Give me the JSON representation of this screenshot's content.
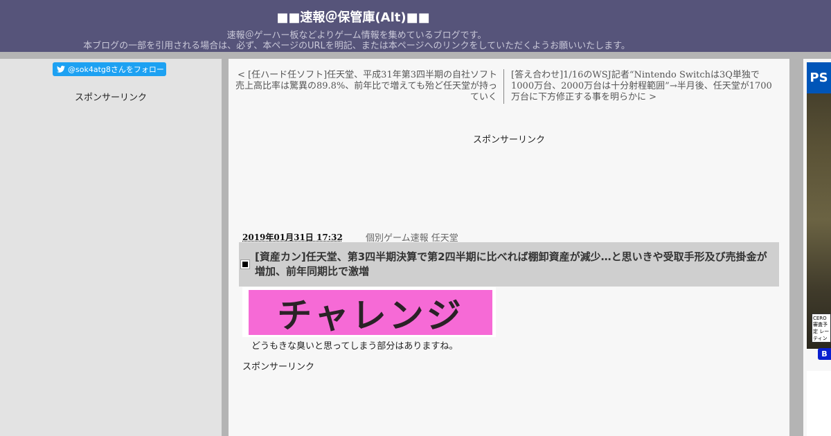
{
  "header": {
    "site_title": "■■速報＠保管庫(Alt)■■",
    "description_line1": "速報＠ゲーハー板などよりゲーム情報を集めているブログです。",
    "description_line2": "本ブログの一部を引用される場合は、必ず、本ページのURLを明記、または本ページへのリンクをしていただくようお願いいたします。"
  },
  "left_sidebar": {
    "twitter_follow_label": "@sok4atg8さんをフォロー",
    "sponsor_link": "スポンサーリンク"
  },
  "nav": {
    "prev_label": "< [任ハード任ソフト]任天堂、平成31年第3四半期の自社ソフト売上高比率は驚異の89.8%、前年比で増えても殆ど任天堂が持っていく",
    "next_label": "[答え合わせ]1/16のWSJ記者“Nintendo Switchは3Q単独で1000万台、2000万台は十分射程範囲”→半月後、任天堂が1700万台に下方修正する事を明らかに >"
  },
  "main": {
    "top_sponsor": "スポンサーリンク",
    "post_date": "2019年01月31日 17:32",
    "post_category": "個別ゲーム速報 任天堂",
    "post_title": "[資産カン]任天堂、第3四半期決算で第2四半期に比べれば棚卸資産が減少…と思いきや受取手形及び売掛金が増加、前年同期比で激増",
    "image_text": "チャレンジ",
    "body_text": "どうもきな臭いと思ってしまう部分はありますね。",
    "bottom_sponsor": "スポンサーリンク"
  },
  "right_sidebar": {
    "ps_logo": "PS",
    "cero_text": "CERO 審査予定 レーティング",
    "button_label": "B"
  },
  "colors": {
    "header_bg": "#56547a",
    "page_bg": "#b4b4b4",
    "title_bar_bg": "#cfcfcf",
    "twitter_blue": "#1da1f2",
    "image_pink": "#f66ad6"
  }
}
